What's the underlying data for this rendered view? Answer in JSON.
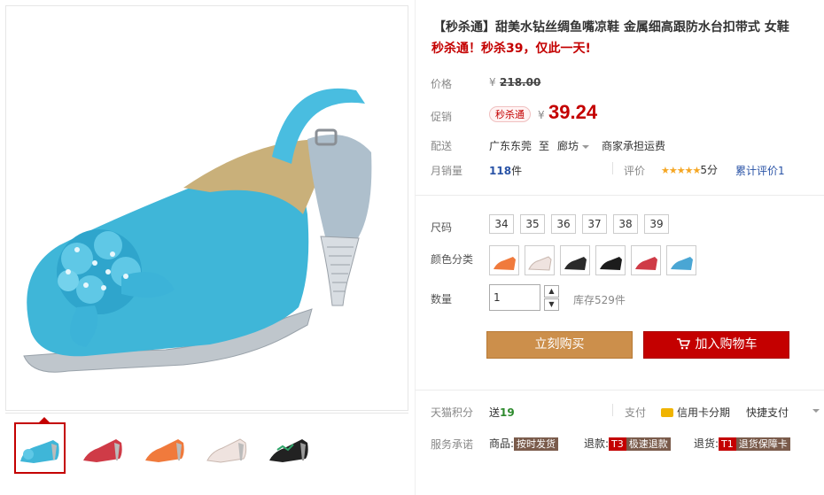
{
  "product": {
    "title": "【秒杀通】甜美水钻丝绸鱼嘴凉鞋 金属细高跟防水台扣带式 女鞋",
    "subtitle": "秒杀通！秒杀39，仅此一天!"
  },
  "price": {
    "label": "价格",
    "currency": "¥",
    "original": "218.00",
    "promo_label": "促销",
    "promo_tag": "秒杀通",
    "promo_price": "39.24"
  },
  "shipping": {
    "label": "配送",
    "from": "广东东莞",
    "to_word": "至",
    "to": "廊坊",
    "fee": "商家承担运费"
  },
  "sales": {
    "label": "月销量",
    "count": "118",
    "unit": "件",
    "rating_label": "评价",
    "stars": "★★★★★",
    "score": "5分",
    "review_count": "累计评价1"
  },
  "sizes": {
    "label": "尺码",
    "options": [
      "34",
      "35",
      "36",
      "37",
      "38",
      "39"
    ]
  },
  "colors": {
    "label": "颜色分类",
    "options": [
      {
        "name": "orange",
        "color": "#f07a3c"
      },
      {
        "name": "white",
        "color": "#efe3df"
      },
      {
        "name": "black-silver",
        "color": "#2a2a2a"
      },
      {
        "name": "black",
        "color": "#1c1c1c"
      },
      {
        "name": "red",
        "color": "#cf3b47"
      },
      {
        "name": "blue",
        "color": "#4aa6d4"
      }
    ]
  },
  "quantity": {
    "label": "数量",
    "value": "1",
    "stock": "库存529件"
  },
  "actions": {
    "buy_now": "立刻购买",
    "add_cart": "加入购物车",
    "cart_icon": "cart-icon"
  },
  "extras": {
    "points_label": "天猫积分",
    "points_prefix": "送",
    "points_value": "19",
    "pay_label": "支付",
    "credit_card": "信用卡分期",
    "quick_pay": "快捷支付",
    "service_label": "服务承诺",
    "svc1_prefix": "商品:",
    "svc1_tag": "按时发货",
    "svc2_prefix": "退款:",
    "svc2_code": "T3",
    "svc2_tag": "极速退款",
    "svc3_prefix": "退货:",
    "svc3_code": "T1",
    "svc3_tag": "退货保障卡"
  },
  "colors_theme": {
    "accent": "#c40000",
    "buy_button": "#cc8f4b",
    "promo_bg": "#fff3f3"
  }
}
